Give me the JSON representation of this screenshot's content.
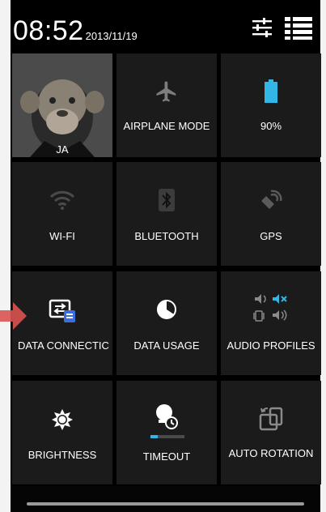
{
  "statusbar": {
    "time": "08:52",
    "date": "2013/11/19",
    "settings_icon": "sliders-icon",
    "list_icon": "list-view-icon"
  },
  "tiles": [
    {
      "label": "JA",
      "icon": "avatar",
      "state": "on"
    },
    {
      "label": "AIRPLANE MODE",
      "icon": "airplane-icon",
      "state": "off"
    },
    {
      "label": "90%",
      "icon": "battery-icon",
      "state": "on"
    },
    {
      "label": "WI-FI",
      "icon": "wifi-icon",
      "state": "off"
    },
    {
      "label": "BLUETOOTH",
      "icon": "bluetooth-icon",
      "state": "off"
    },
    {
      "label": "GPS",
      "icon": "gps-icon",
      "state": "off"
    },
    {
      "label": "DATA CONNECTIC",
      "icon": "data-connection-icon",
      "state": "on"
    },
    {
      "label": "DATA USAGE",
      "icon": "data-usage-icon",
      "state": "on"
    },
    {
      "label": "AUDIO PROFILES",
      "icon": "audio-profiles-icon",
      "state": "on"
    },
    {
      "label": "BRIGHTNESS",
      "icon": "brightness-icon",
      "state": "on"
    },
    {
      "label": "TIMEOUT",
      "icon": "timeout-icon",
      "state": "on"
    },
    {
      "label": "AUTO ROTATION",
      "icon": "rotation-icon",
      "state": "off"
    }
  ],
  "colors": {
    "accent": "#33b5e5",
    "highlight_arrow": "#d9534f",
    "tile_bg": "#1b1b1b"
  }
}
